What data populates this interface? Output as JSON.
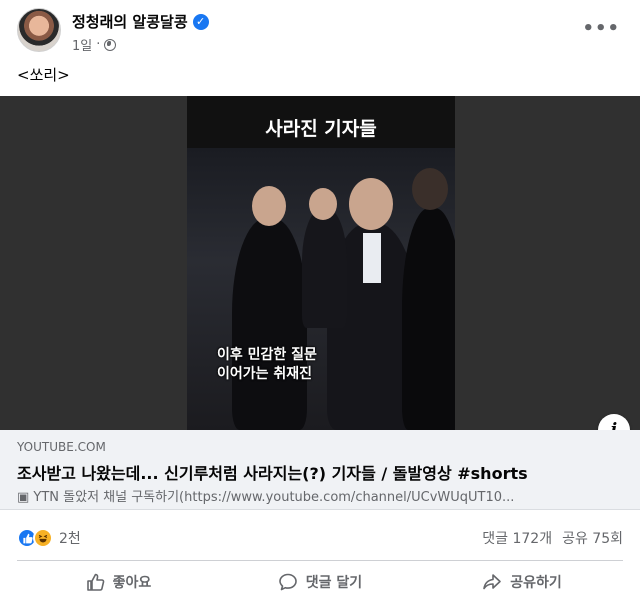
{
  "post": {
    "author": "정청래의 알콩달콩",
    "time": "1일",
    "more_label": "•••",
    "text": "<쏘리>"
  },
  "video": {
    "overlay_title": "사라진 기자들",
    "caption_line1": "이후 민감한 질문",
    "caption_line2": "이어가는 취재진",
    "info_label": "i"
  },
  "link": {
    "domain": "YOUTUBE.COM",
    "title": "조사받고 나왔는데... 신기루처럼 사라지는(?) 기자들 / 돌발영상 #shorts",
    "description": "▣ YTN 돌았저 채널 구독하기(https://www.youtube.com/channel/UCvWUqUT10..."
  },
  "engagement": {
    "reaction_count": "2천",
    "comments": "댓글 172개",
    "shares": "공유 75회"
  },
  "actions": {
    "like": "좋아요",
    "comment": "댓글 달기",
    "share": "공유하기"
  },
  "colors": {
    "accent": "#1877f2",
    "secondary_text": "#65676b",
    "link_bg": "#f0f2f5"
  }
}
